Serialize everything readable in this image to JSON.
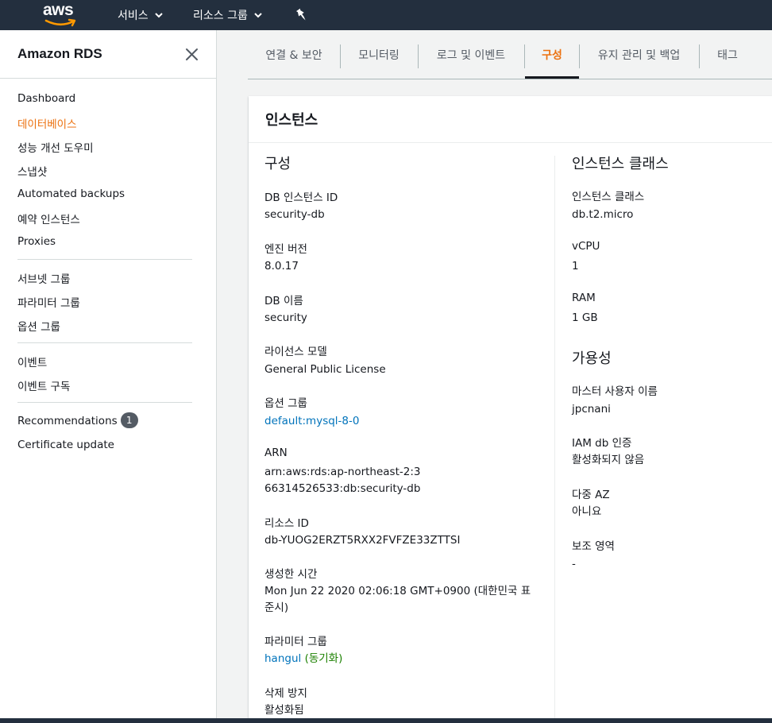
{
  "topnav": {
    "logo_text": "aws",
    "services": "서비스",
    "resource_groups": "리소스 그룹",
    "colors": {
      "bg": "#232f3e",
      "smile": "#ff9900"
    }
  },
  "sidebar": {
    "title": "Amazon RDS",
    "items": [
      {
        "label": "Dashboard"
      },
      {
        "label": "데이터베이스"
      },
      {
        "label": "성능 개선 도우미"
      },
      {
        "label": "스냅샷"
      },
      {
        "label": "Automated backups"
      },
      {
        "label": "예약 인스턴스"
      },
      {
        "label": "Proxies"
      },
      {
        "label": "서브넷 그룹"
      },
      {
        "label": "파라미터 그룹"
      },
      {
        "label": "옵션 그룹"
      },
      {
        "label": "이벤트"
      },
      {
        "label": "이벤트 구독"
      },
      {
        "label": "Recommendations",
        "badge": "1"
      },
      {
        "label": "Certificate update"
      }
    ],
    "active_color": "#ec7211"
  },
  "tabs": [
    {
      "label": "연결 & 보안"
    },
    {
      "label": "모니터링"
    },
    {
      "label": "로그 및 이벤트"
    },
    {
      "label": "구성"
    },
    {
      "label": "유지 관리 및 백업"
    },
    {
      "label": "태그"
    }
  ],
  "panel": {
    "title": "인스턴스",
    "left": {
      "section_title": "구성",
      "fields": [
        {
          "label": "DB 인스턴스 ID",
          "value": "security-db"
        },
        {
          "label": "엔진 버전",
          "value": "8.0.17"
        },
        {
          "label": "DB 이름",
          "value": "security"
        },
        {
          "label": "라이선스 모델",
          "value": "General Public License"
        },
        {
          "label": "옵션 그룹",
          "value": "default:mysql-8-0"
        },
        {
          "label": "ARN",
          "value": "arn:aws:rds:ap-northeast-2:366314526533:db:security-db"
        },
        {
          "label": "리소스 ID",
          "value": "db-YUOG2ERZT5RXX2FVFZE33ZTTSI"
        },
        {
          "label": "생성한 시간",
          "value": "Mon Jun 22 2020 02:06:18 GMT+0900 (대한민국 표준시)"
        },
        {
          "label": "파라미터 그룹",
          "value": "hangul",
          "status": "(동기화)"
        },
        {
          "label": "삭제 방지",
          "value": "활성화됨"
        }
      ]
    },
    "right": {
      "section_title_1": "인스턴스 클래스",
      "class_fields": [
        {
          "label": "인스턴스 클래스",
          "value": "db.t2.micro"
        },
        {
          "label": "vCPU",
          "value": "1"
        },
        {
          "label": "RAM",
          "value": "1 GB"
        }
      ],
      "section_title_2": "가용성",
      "availability_fields": [
        {
          "label": "마스터 사용자 이름",
          "value": "jpcnani"
        },
        {
          "label": "IAM db 인증",
          "value": "활성화되지 않음"
        },
        {
          "label": "다중 AZ",
          "value": "아니요"
        },
        {
          "label": "보조 영역",
          "value": "-"
        }
      ]
    }
  }
}
